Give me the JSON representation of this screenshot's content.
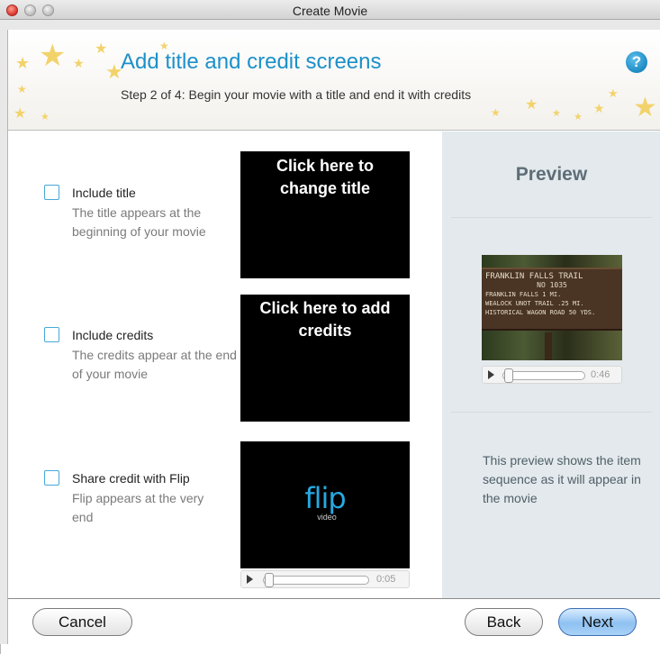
{
  "window": {
    "title": "Create Movie"
  },
  "header": {
    "title": "Add title and credit screens",
    "subtitle": "Step 2 of 4: Begin your movie with a title and end it with credits",
    "help_glyph": "?"
  },
  "options": [
    {
      "label": "Include title",
      "description": "The title appears at the beginning of your movie",
      "checked": false
    },
    {
      "label": "Include credits",
      "description": "The credits appear at the end of your movie",
      "checked": false
    },
    {
      "label": "Share credit with Flip",
      "description": "Flip appears at the very end",
      "checked": false
    }
  ],
  "thumbnails": {
    "title_text": "Click here to change title",
    "credits_text": "Click here to add credits",
    "flip_logo": "flip",
    "flip_logo_sub": "video",
    "flip_time": "0:05"
  },
  "preview": {
    "heading": "Preview",
    "time": "0:46",
    "description": "This preview shows the item sequence as it will appear in the movie",
    "sign_lines": [
      "FRANKLIN FALLS TRAIL",
      "NO 1035",
      "FRANKLIN FALLS 1 MI.",
      "WEALOCK UNOT TRAIL .25 MI.",
      "HISTORICAL WAGON ROAD 50 YDS."
    ]
  },
  "footer": {
    "cancel_label": "Cancel",
    "back_label": "Back",
    "next_label": "Next"
  },
  "colors": {
    "accent": "#1c90c9",
    "preview_bg": "#e3e9ec",
    "checkbox_border": "#49a7d8"
  }
}
